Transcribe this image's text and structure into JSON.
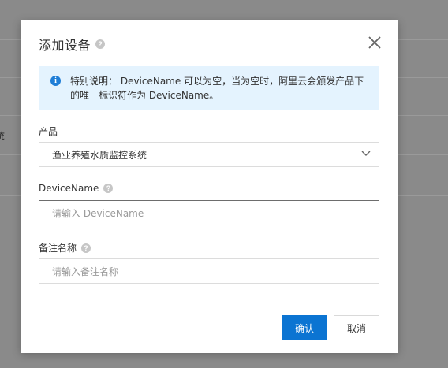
{
  "background": {
    "fragment_text": "统"
  },
  "dialog": {
    "title": "添加设备",
    "help_glyph": "?",
    "close_icon": "close-icon",
    "notice": {
      "icon": "info-icon",
      "text": "特别说明： DeviceName 可以为空，当为空时，阿里云会颁发产品下的唯一标识符作为 DeviceName。"
    },
    "product": {
      "label": "产品",
      "value": "渔业养殖水质监控系统"
    },
    "device_name": {
      "label": "DeviceName",
      "placeholder": "请输入 DeviceName"
    },
    "remark": {
      "label": "备注名称",
      "placeholder": "请输入备注名称"
    },
    "buttons": {
      "confirm": "确认",
      "cancel": "取消"
    }
  },
  "colors": {
    "primary": "#0b74d2",
    "notice_bg": "#e4f3fe",
    "overlay": "#8a8a8a"
  }
}
